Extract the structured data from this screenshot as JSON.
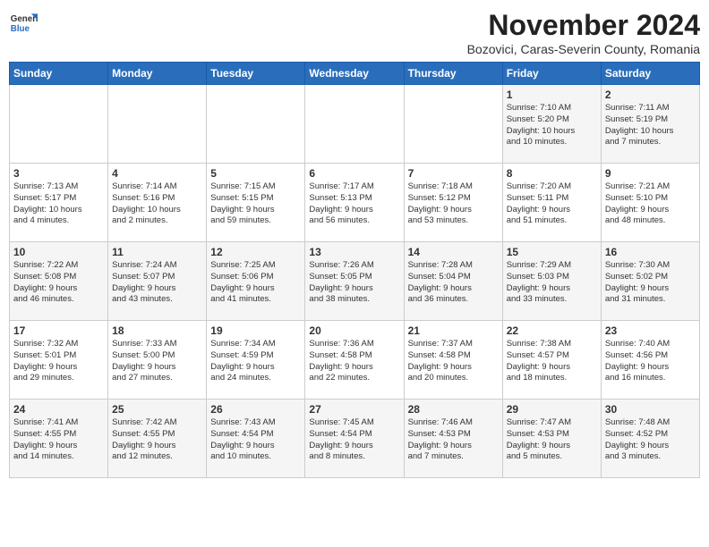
{
  "header": {
    "logo_line1": "General",
    "logo_line2": "Blue",
    "month": "November 2024",
    "location": "Bozovici, Caras-Severin County, Romania"
  },
  "weekdays": [
    "Sunday",
    "Monday",
    "Tuesday",
    "Wednesday",
    "Thursday",
    "Friday",
    "Saturday"
  ],
  "weeks": [
    [
      {
        "day": "",
        "info": ""
      },
      {
        "day": "",
        "info": ""
      },
      {
        "day": "",
        "info": ""
      },
      {
        "day": "",
        "info": ""
      },
      {
        "day": "",
        "info": ""
      },
      {
        "day": "1",
        "info": "Sunrise: 7:10 AM\nSunset: 5:20 PM\nDaylight: 10 hours\nand 10 minutes."
      },
      {
        "day": "2",
        "info": "Sunrise: 7:11 AM\nSunset: 5:19 PM\nDaylight: 10 hours\nand 7 minutes."
      }
    ],
    [
      {
        "day": "3",
        "info": "Sunrise: 7:13 AM\nSunset: 5:17 PM\nDaylight: 10 hours\nand 4 minutes."
      },
      {
        "day": "4",
        "info": "Sunrise: 7:14 AM\nSunset: 5:16 PM\nDaylight: 10 hours\nand 2 minutes."
      },
      {
        "day": "5",
        "info": "Sunrise: 7:15 AM\nSunset: 5:15 PM\nDaylight: 9 hours\nand 59 minutes."
      },
      {
        "day": "6",
        "info": "Sunrise: 7:17 AM\nSunset: 5:13 PM\nDaylight: 9 hours\nand 56 minutes."
      },
      {
        "day": "7",
        "info": "Sunrise: 7:18 AM\nSunset: 5:12 PM\nDaylight: 9 hours\nand 53 minutes."
      },
      {
        "day": "8",
        "info": "Sunrise: 7:20 AM\nSunset: 5:11 PM\nDaylight: 9 hours\nand 51 minutes."
      },
      {
        "day": "9",
        "info": "Sunrise: 7:21 AM\nSunset: 5:10 PM\nDaylight: 9 hours\nand 48 minutes."
      }
    ],
    [
      {
        "day": "10",
        "info": "Sunrise: 7:22 AM\nSunset: 5:08 PM\nDaylight: 9 hours\nand 46 minutes."
      },
      {
        "day": "11",
        "info": "Sunrise: 7:24 AM\nSunset: 5:07 PM\nDaylight: 9 hours\nand 43 minutes."
      },
      {
        "day": "12",
        "info": "Sunrise: 7:25 AM\nSunset: 5:06 PM\nDaylight: 9 hours\nand 41 minutes."
      },
      {
        "day": "13",
        "info": "Sunrise: 7:26 AM\nSunset: 5:05 PM\nDaylight: 9 hours\nand 38 minutes."
      },
      {
        "day": "14",
        "info": "Sunrise: 7:28 AM\nSunset: 5:04 PM\nDaylight: 9 hours\nand 36 minutes."
      },
      {
        "day": "15",
        "info": "Sunrise: 7:29 AM\nSunset: 5:03 PM\nDaylight: 9 hours\nand 33 minutes."
      },
      {
        "day": "16",
        "info": "Sunrise: 7:30 AM\nSunset: 5:02 PM\nDaylight: 9 hours\nand 31 minutes."
      }
    ],
    [
      {
        "day": "17",
        "info": "Sunrise: 7:32 AM\nSunset: 5:01 PM\nDaylight: 9 hours\nand 29 minutes."
      },
      {
        "day": "18",
        "info": "Sunrise: 7:33 AM\nSunset: 5:00 PM\nDaylight: 9 hours\nand 27 minutes."
      },
      {
        "day": "19",
        "info": "Sunrise: 7:34 AM\nSunset: 4:59 PM\nDaylight: 9 hours\nand 24 minutes."
      },
      {
        "day": "20",
        "info": "Sunrise: 7:36 AM\nSunset: 4:58 PM\nDaylight: 9 hours\nand 22 minutes."
      },
      {
        "day": "21",
        "info": "Sunrise: 7:37 AM\nSunset: 4:58 PM\nDaylight: 9 hours\nand 20 minutes."
      },
      {
        "day": "22",
        "info": "Sunrise: 7:38 AM\nSunset: 4:57 PM\nDaylight: 9 hours\nand 18 minutes."
      },
      {
        "day": "23",
        "info": "Sunrise: 7:40 AM\nSunset: 4:56 PM\nDaylight: 9 hours\nand 16 minutes."
      }
    ],
    [
      {
        "day": "24",
        "info": "Sunrise: 7:41 AM\nSunset: 4:55 PM\nDaylight: 9 hours\nand 14 minutes."
      },
      {
        "day": "25",
        "info": "Sunrise: 7:42 AM\nSunset: 4:55 PM\nDaylight: 9 hours\nand 12 minutes."
      },
      {
        "day": "26",
        "info": "Sunrise: 7:43 AM\nSunset: 4:54 PM\nDaylight: 9 hours\nand 10 minutes."
      },
      {
        "day": "27",
        "info": "Sunrise: 7:45 AM\nSunset: 4:54 PM\nDaylight: 9 hours\nand 8 minutes."
      },
      {
        "day": "28",
        "info": "Sunrise: 7:46 AM\nSunset: 4:53 PM\nDaylight: 9 hours\nand 7 minutes."
      },
      {
        "day": "29",
        "info": "Sunrise: 7:47 AM\nSunset: 4:53 PM\nDaylight: 9 hours\nand 5 minutes."
      },
      {
        "day": "30",
        "info": "Sunrise: 7:48 AM\nSunset: 4:52 PM\nDaylight: 9 hours\nand 3 minutes."
      }
    ]
  ]
}
